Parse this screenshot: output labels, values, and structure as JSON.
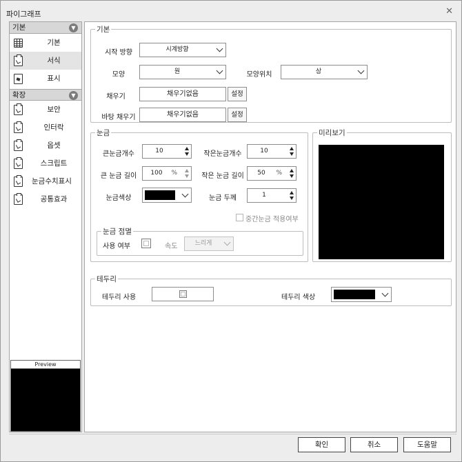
{
  "window": {
    "title": "파이그래프",
    "close_icon": "close-icon"
  },
  "sidebar": {
    "groups": [
      {
        "label": "기본",
        "items": [
          {
            "label": "기본",
            "icon": "grid-icon"
          },
          {
            "label": "서식",
            "icon": "clipboard-icon",
            "active": true
          },
          {
            "label": "표시",
            "icon": "document-icon"
          }
        ]
      },
      {
        "label": "확장",
        "items": [
          {
            "label": "보안",
            "icon": "clipboard-icon"
          },
          {
            "label": "인터락",
            "icon": "clipboard-icon"
          },
          {
            "label": "옵셋",
            "icon": "clipboard-icon"
          },
          {
            "label": "스크립트",
            "icon": "clipboard-icon"
          },
          {
            "label": "눈금수치표시",
            "icon": "clipboard-icon"
          },
          {
            "label": "공통효과",
            "icon": "clipboard-icon"
          }
        ]
      }
    ],
    "preview_label": "Preview"
  },
  "basic": {
    "legend": "기본",
    "start_direction": {
      "label": "시작 방향",
      "value": "시계방향"
    },
    "shape": {
      "label": "모양",
      "value": "원"
    },
    "shape_position": {
      "label": "모양위치",
      "value": "상"
    },
    "fill": {
      "label": "채우기",
      "value": "채우기없음",
      "button": "설정"
    },
    "background_fill": {
      "label": "바탕 채우기",
      "value": "채우기없음",
      "button": "설정"
    }
  },
  "scale": {
    "legend": "눈금",
    "major_count": {
      "label": "큰눈금개수",
      "value": "10"
    },
    "minor_count": {
      "label": "작은눈금개수",
      "value": "10"
    },
    "major_length": {
      "label": "큰 눈금 길이",
      "value": "100",
      "unit": "%"
    },
    "minor_length": {
      "label": "작은 눈금 길이",
      "value": "50",
      "unit": "%"
    },
    "color": {
      "label": "눈금색상",
      "value": "#000000"
    },
    "thickness": {
      "label": "눈금 두께",
      "value": "1"
    },
    "middle_scale": {
      "label": "중간눈금 적용여부"
    },
    "blink": {
      "legend": "눈금 점멸",
      "use_label": "사용 여부",
      "speed_label": "속도",
      "speed_value": "느리게"
    }
  },
  "preview_panel": {
    "legend": "미리보기"
  },
  "border": {
    "legend": "테두리",
    "use_label": "테두리 사용",
    "color_label": "테두리 색상",
    "color_value": "#000000"
  },
  "footer": {
    "ok": "확인",
    "cancel": "취소",
    "help": "도움말"
  }
}
